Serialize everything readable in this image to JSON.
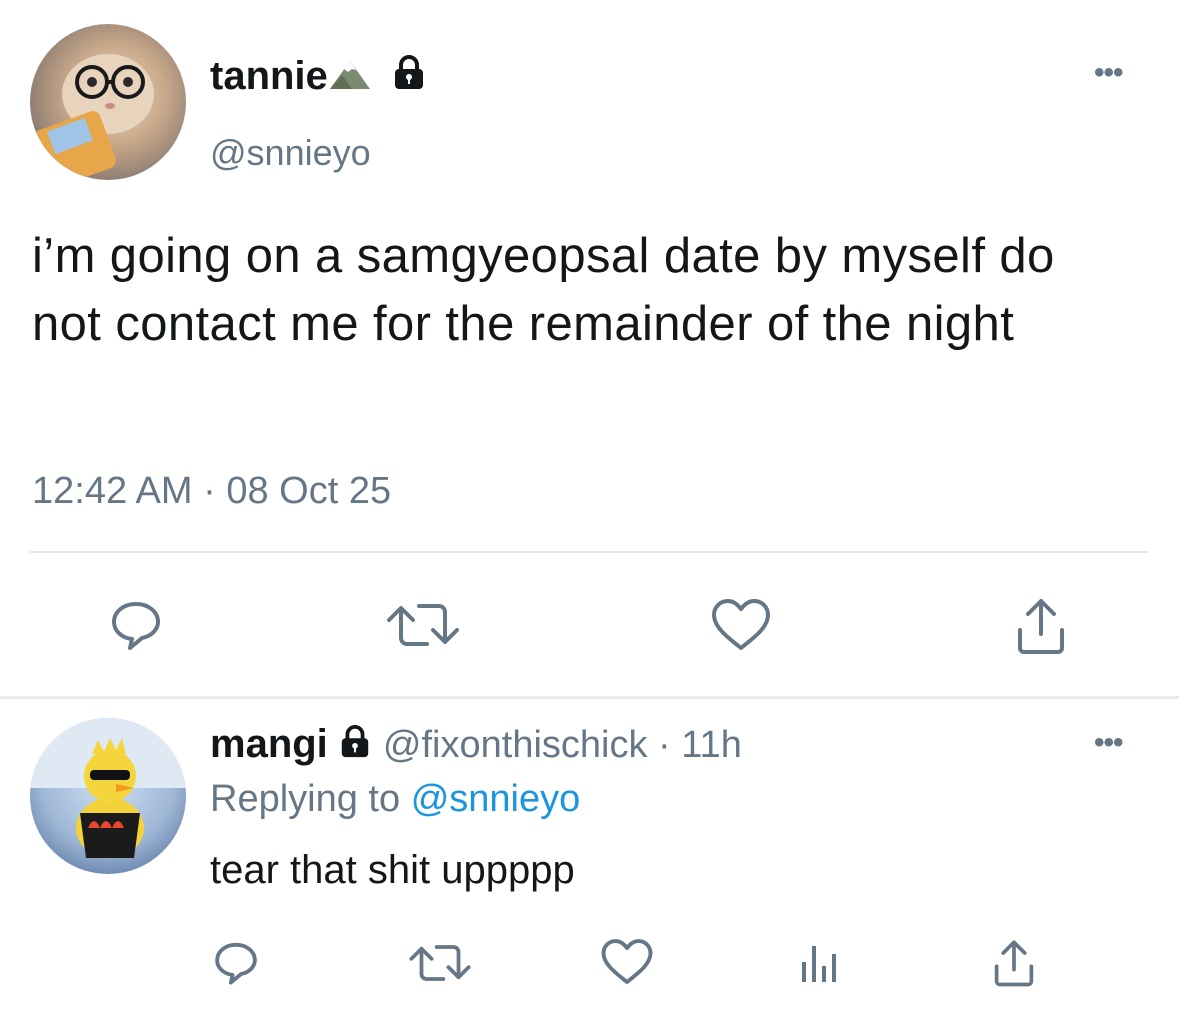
{
  "main_tweet": {
    "display_name": "tannie",
    "handle": "@snnieyo",
    "text": "i’m going on a samgyeopsal date by myself do not contact me for the remainder of the night",
    "timestamp": "12:42 AM · 08 Oct 25",
    "more_label": "•••"
  },
  "reply_tweet": {
    "display_name": "mangi",
    "handle_meta": "@fixonthischick · 11h",
    "replying_prefix": "Replying to",
    "replying_mention": "@snnieyo",
    "text": "tear that shit uppppp",
    "more_label": "•••"
  },
  "icons": {
    "reply": "reply-icon",
    "retweet": "retweet-icon",
    "like": "heart-icon",
    "share": "share-icon",
    "stats": "analytics-icon",
    "lock": "lock-icon",
    "mountain": "mountain-emoji"
  },
  "colors": {
    "text": "#14171a",
    "secondary": "#657786",
    "mention": "#1b95e0",
    "divider": "#e1e8ed"
  }
}
